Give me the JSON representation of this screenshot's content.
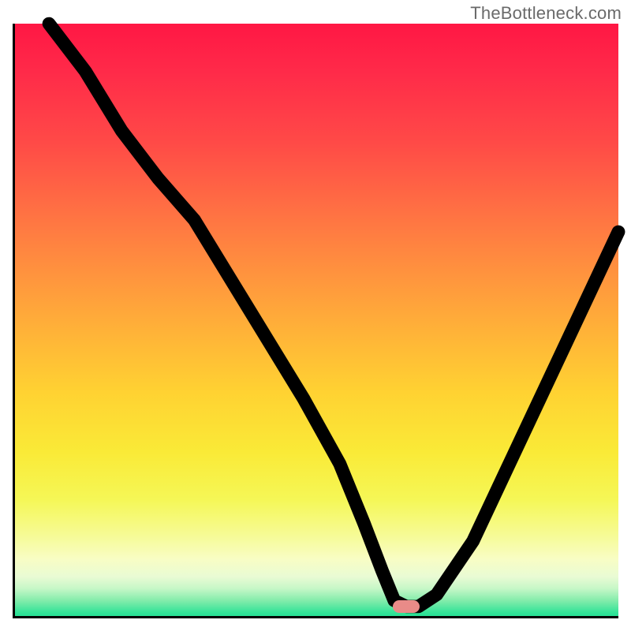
{
  "watermark": "TheBottleneck.com",
  "chart_data": {
    "type": "line",
    "title": "",
    "xlabel": "",
    "ylabel": "",
    "xlim": [
      0,
      100
    ],
    "ylim": [
      0,
      100
    ],
    "grid": false,
    "legend": false,
    "gradient_colors": {
      "top": "#ff1744",
      "mid_high": "#ff933e",
      "mid": "#ffd232",
      "mid_low": "#f5f756",
      "bottom": "#1fde93"
    },
    "marker": {
      "x": 65,
      "y": 2,
      "color": "#e98b88"
    },
    "series": [
      {
        "name": "bottleneck-curve",
        "x": [
          6,
          12,
          18,
          24,
          30,
          36,
          42,
          48,
          54,
          58,
          61,
          63,
          65,
          67,
          70,
          76,
          82,
          88,
          94,
          100
        ],
        "y": [
          100,
          92,
          82,
          74,
          67,
          57,
          47,
          37,
          26,
          16,
          8,
          3,
          2,
          2,
          4,
          13,
          26,
          39,
          52,
          65
        ]
      }
    ]
  }
}
